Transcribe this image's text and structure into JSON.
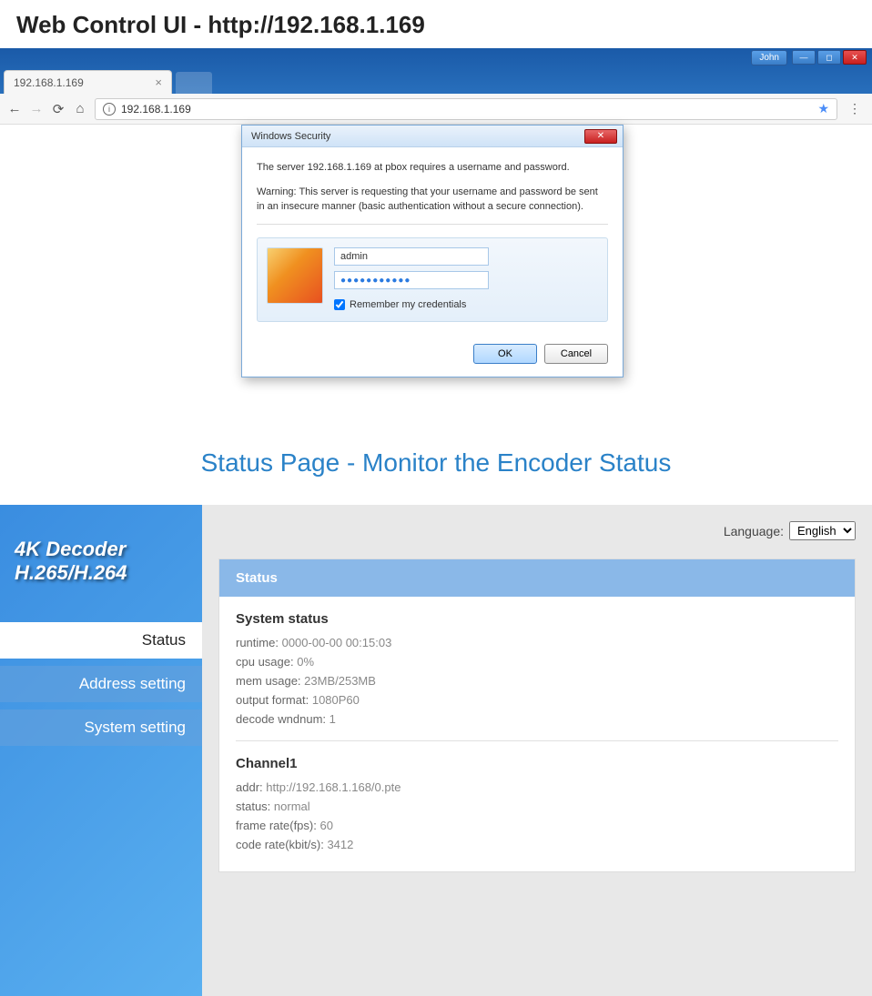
{
  "header_title": "Web Control UI - http://192.168.1.169",
  "titlebar": {
    "user": "John"
  },
  "browser": {
    "tab_label": "192.168.1.169",
    "address": "192.168.1.169"
  },
  "dialog": {
    "title": "Windows Security",
    "line1": "The server 192.168.1.169 at pbox requires a username and password.",
    "warning": "Warning: This server is requesting that your username and password be sent in an insecure manner (basic authentication without a secure connection).",
    "username": "admin",
    "password": "●●●●●●●●●●●",
    "remember_label": "Remember my credentials",
    "ok": "OK",
    "cancel": "Cancel"
  },
  "section_heading": "Status Page - Monitor the Encoder Status",
  "sidebar": {
    "logo_line1": "4K Decoder",
    "logo_line2": "H.265/H.264",
    "items": [
      {
        "label": "Status",
        "active": true
      },
      {
        "label": "Address setting",
        "active": false
      },
      {
        "label": "System setting",
        "active": false
      }
    ]
  },
  "language": {
    "label": "Language:",
    "selected": "English"
  },
  "panel": {
    "title": "Status",
    "system": {
      "heading": "System status",
      "runtime_label": "runtime:",
      "runtime": "0000-00-00 00:15:03",
      "cpu_label": "cpu usage:",
      "cpu": "0%",
      "mem_label": "mem usage:",
      "mem": "23MB/253MB",
      "out_label": "output format:",
      "out": "1080P60",
      "wnd_label": "decode wndnum:",
      "wnd": "1"
    },
    "channel": {
      "heading": "Channel1",
      "addr_label": "addr:",
      "addr": "http://192.168.1.168/0.pte",
      "status_label": "status:",
      "status": "normal",
      "fps_label": "frame rate(fps):",
      "fps": "60",
      "rate_label": "code rate(kbit/s):",
      "rate": "3412"
    }
  }
}
